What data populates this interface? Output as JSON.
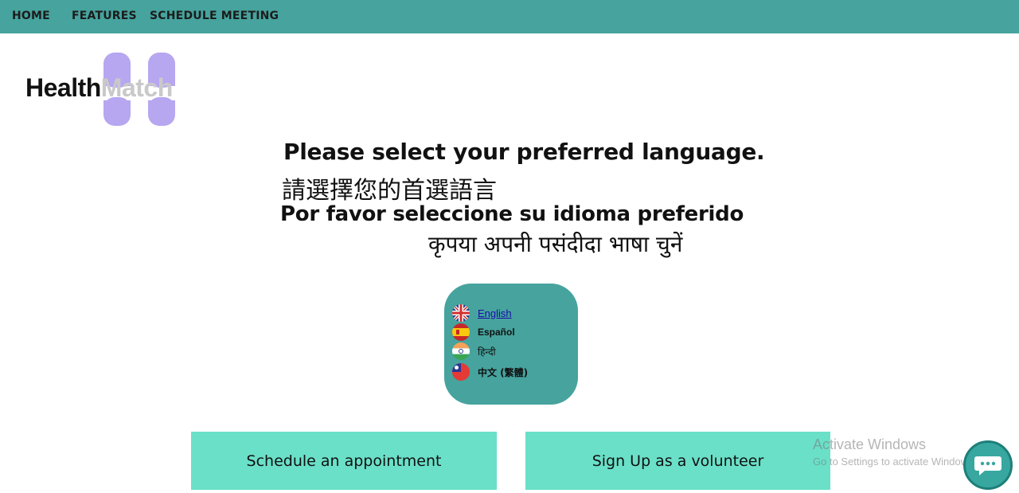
{
  "nav": {
    "home": "HOME",
    "features": "FEATURES",
    "schedule": "SCHEDULE MEETING"
  },
  "logo": {
    "part1": "Health",
    "part2": "Match"
  },
  "headings": {
    "english": "Please select your preferred language.",
    "chinese": "請選擇您的首選語言",
    "spanish": "Por favor seleccione su idioma preferido",
    "hindi": "कृपया अपनी पसंदीदा भाषा चुनें"
  },
  "languages": [
    {
      "label": "English",
      "icon": "uk-flag-icon"
    },
    {
      "label": "Español",
      "icon": "spain-flag-icon"
    },
    {
      "label": "हिन्दी",
      "icon": "india-flag-icon"
    },
    {
      "label": "中文 (繁體)",
      "icon": "taiwan-flag-icon"
    }
  ],
  "buttons": {
    "appointment": "Schedule an appointment",
    "volunteer": "Sign Up as a volunteer"
  },
  "watermark": {
    "title": "Activate Windows",
    "subtitle": "Go to Settings to activate Windows."
  },
  "colors": {
    "nav_bg": "#46a39d",
    "lang_box_bg": "#46a39d",
    "cta_bg": "#6ae0c8",
    "logo_accent": "#b7a6f0"
  }
}
